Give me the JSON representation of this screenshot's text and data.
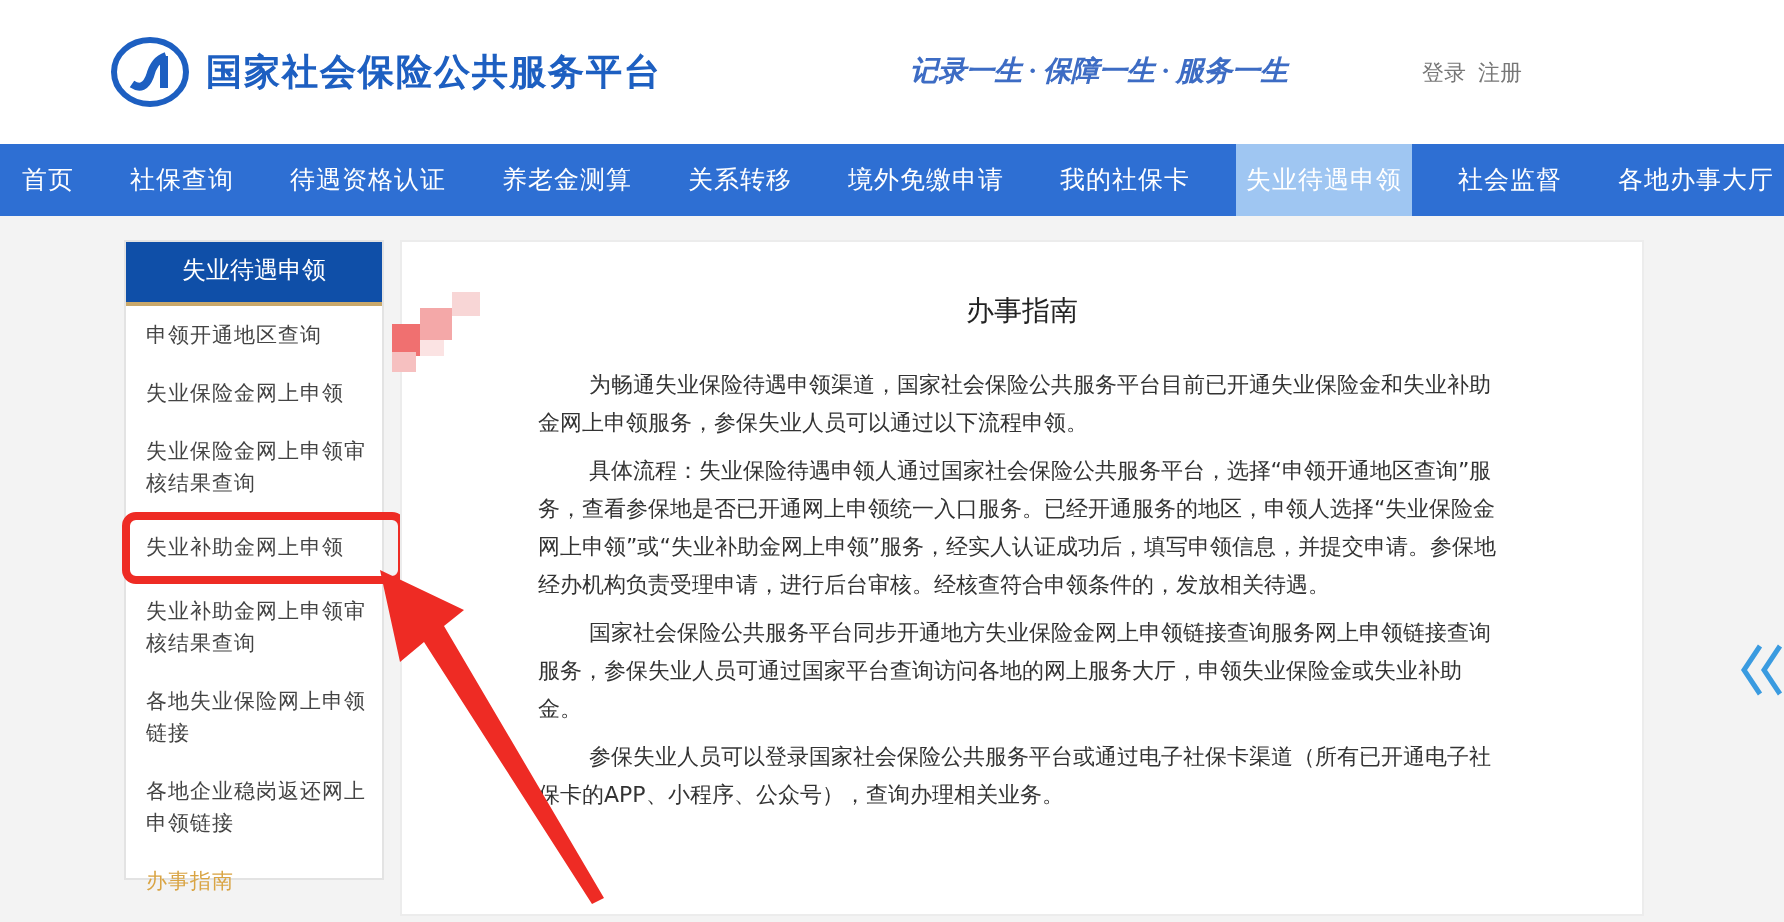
{
  "header": {
    "site_title": "国家社会保险公共服务平台",
    "slogan": "记录一生 · 保障一生 · 服务一生",
    "links": [
      "登录",
      "注册"
    ]
  },
  "nav": [
    {
      "label": "首页",
      "selected": false
    },
    {
      "label": "社保查询",
      "selected": false
    },
    {
      "label": "待遇资格认证",
      "selected": false
    },
    {
      "label": "养老金测算",
      "selected": false
    },
    {
      "label": "关系转移",
      "selected": false
    },
    {
      "label": "境外免缴申请",
      "selected": false
    },
    {
      "label": "我的社保卡",
      "selected": false
    },
    {
      "label": "失业待遇申领",
      "selected": true
    },
    {
      "label": "社会监督",
      "selected": false
    },
    {
      "label": "各地办事大厅",
      "selected": false
    }
  ],
  "sidebar": {
    "title": "失业待遇申领",
    "items": [
      {
        "label": "申领开通地区查询",
        "selected": false,
        "highlighted": false
      },
      {
        "label": "失业保险金网上申领",
        "selected": false,
        "highlighted": false
      },
      {
        "label": "失业保险金网上申领审核结果查询",
        "selected": false,
        "highlighted": false
      },
      {
        "label": "失业补助金网上申领",
        "selected": false,
        "highlighted": true
      },
      {
        "label": "失业补助金网上申领审核结果查询",
        "selected": false,
        "highlighted": false
      },
      {
        "label": "各地失业保险网上申领链接",
        "selected": false,
        "highlighted": false
      },
      {
        "label": "各地企业稳岗返还网上申领链接",
        "selected": false,
        "highlighted": false
      },
      {
        "label": "办事指南",
        "selected": true,
        "highlighted": false
      }
    ]
  },
  "content": {
    "title": "办事指南",
    "paragraphs": [
      "为畅通失业保险待遇申领渠道，国家社会保险公共服务平台目前已开通失业保险金和失业补助金网上申领服务，参保失业人员可以通过以下流程申领。",
      "具体流程：失业保险待遇申领人通过国家社会保险公共服务平台，选择“申领开通地区查询”服务，查看参保地是否已开通网上申领统一入口服务。已经开通服务的地区，申领人选择“失业保险金网上申领”或“失业补助金网上申领”服务，经实人认证成功后，填写申领信息，并提交申请。参保地经办机构负责受理申请，进行后台审核。经核查符合申领条件的，发放相关待遇。",
      "国家社会保险公共服务平台同步开通地方失业保险金网上申领链接查询服务网上申领链接查询服务，参保失业人员可通过国家平台查询访问各地的网上服务大厅，申领失业保险金或失业补助金。",
      "参保失业人员可以登录国家社会保险公共服务平台或通过电子社保卡渠道（所有已开通电子社保卡的APP、小程序、公众号），查询办理相关业务。"
    ]
  }
}
